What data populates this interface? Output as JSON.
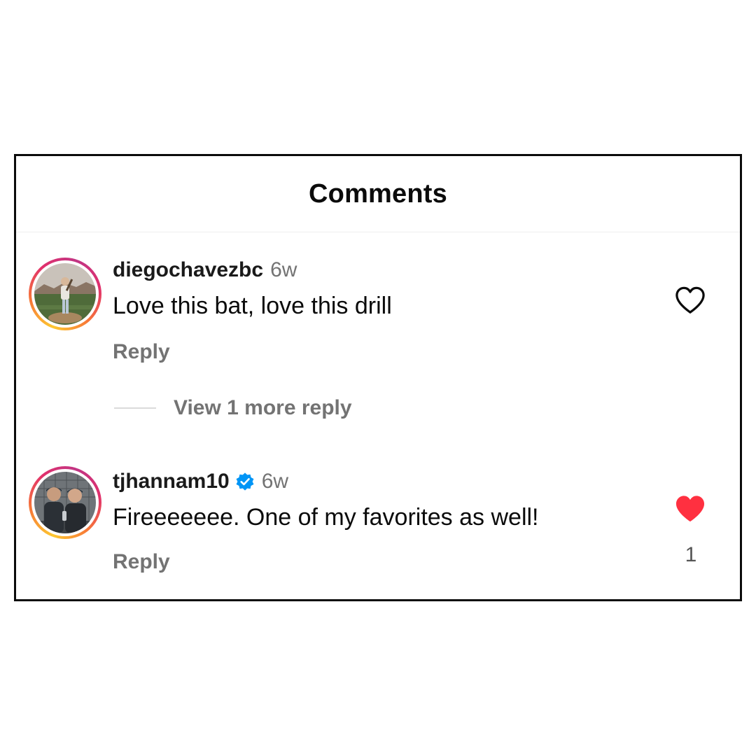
{
  "header": {
    "title": "Comments"
  },
  "comments": [
    {
      "username": "diegochavezbc",
      "time": "6w",
      "text": "Love this bat, love this drill",
      "reply_label": "Reply",
      "liked": false,
      "like_icon": "heart-outline-icon",
      "view_replies_label": "View 1 more reply"
    },
    {
      "username": "tjhannam10",
      "verified": true,
      "time": "6w",
      "text": "Fireeeeeee. One of my favorites as well!",
      "reply_label": "Reply",
      "liked": true,
      "like_icon": "heart-filled-icon",
      "like_count": "1"
    }
  ],
  "colors": {
    "like_red": "#ff3040",
    "verified_blue": "#0095f6",
    "secondary_text": "#737373",
    "primary_text": "#0b0b0b"
  }
}
